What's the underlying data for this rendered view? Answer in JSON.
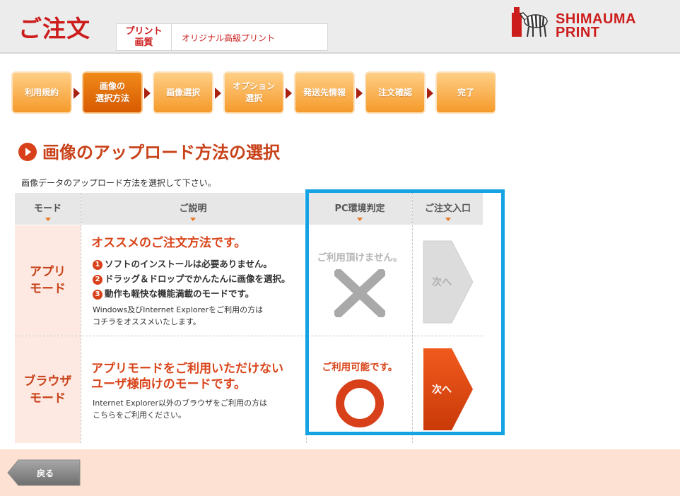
{
  "header": {
    "title": "ご注文",
    "info_label": "プリント\n画質",
    "info_value": "オリジナル高級プリント",
    "logo_line1": "SHIMAUMA",
    "logo_line2": "PRINT"
  },
  "steps": [
    {
      "label": "利用規約",
      "active": false
    },
    {
      "label": "画像の\n選択方法",
      "active": true
    },
    {
      "label": "画像選択",
      "active": false
    },
    {
      "label": "オプション\n選択",
      "active": false
    },
    {
      "label": "発送先情報",
      "active": false
    },
    {
      "label": "注文確認",
      "active": false
    },
    {
      "label": "完了",
      "active": false
    }
  ],
  "section": {
    "title": "画像のアップロード方法の選択",
    "instruction": "画像データのアップロード方法を選択して下さい。"
  },
  "table": {
    "headers": [
      "モード",
      "ご説明",
      "PC環境判定",
      "ご注文入口"
    ],
    "rows": [
      {
        "mode": "アプリ\nモード",
        "headline": "オススメのご注文方法です。",
        "features": [
          "ソフトのインストールは必要ありません。",
          "ドラッグ＆ドロップでかんたんに画像を選択。",
          "動作も軽快な機能満載のモードです。"
        ],
        "feature_numbers": [
          "1",
          "2",
          "3"
        ],
        "note": "Windows及びInternet Explorerをご利用の方は\nコチラをオススメいたします。",
        "status": "ご利用頂けません。",
        "next_label": "次へ"
      },
      {
        "mode": "ブラウザ\nモード",
        "headline": "アプリモードをご利用いただけない\nユーザ様向けのモードです。",
        "note": "Internet Explorer以外のブラウザをご利用の方は\nこちらをご利用ください。",
        "status": "ご利用可能です。",
        "next_label": "次へ"
      }
    ]
  },
  "footer": {
    "back_label": "戻る"
  },
  "colors": {
    "brand_red": "#cc1c1c",
    "accent_orange": "#d8401a",
    "highlight_blue": "#15a3e3",
    "step_orange": "#f59a2a"
  }
}
